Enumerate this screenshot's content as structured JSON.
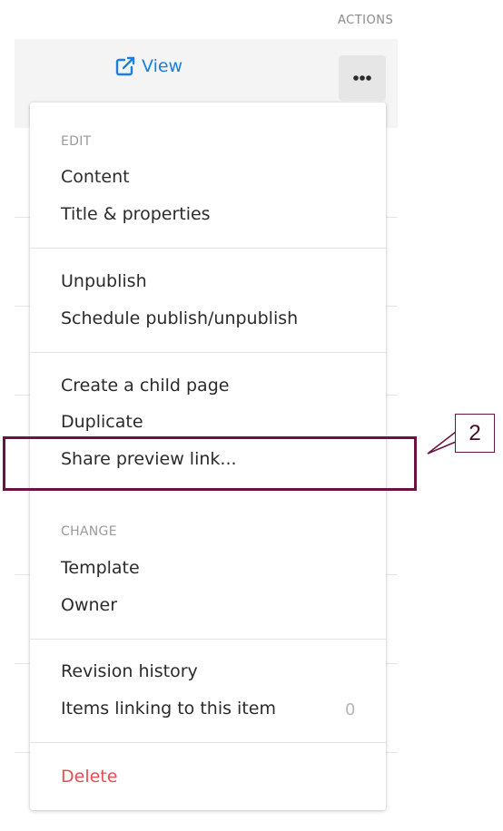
{
  "table": {
    "actions_header": "ACTIONS",
    "view_link_label": "View"
  },
  "menu": {
    "edit_section_label": "EDIT",
    "content_label": "Content",
    "title_properties_label": "Title & properties",
    "unpublish_label": "Unpublish",
    "schedule_label": "Schedule publish/unpublish",
    "create_child_label": "Create a child page",
    "duplicate_label": "Duplicate",
    "share_preview_label": "Share preview link...",
    "change_section_label": "CHANGE",
    "template_label": "Template",
    "owner_label": "Owner",
    "revision_history_label": "Revision history",
    "items_linking_label": "Items linking to this item",
    "items_linking_count": "0",
    "delete_label": "Delete"
  },
  "annotation": {
    "callout_number": "2"
  },
  "colors": {
    "link": "#1a7fe3",
    "danger": "#ec4d55",
    "annotation": "#6a1240"
  },
  "icons": {
    "view_icon": "external-link-icon",
    "more_icon": "ellipsis-icon"
  }
}
